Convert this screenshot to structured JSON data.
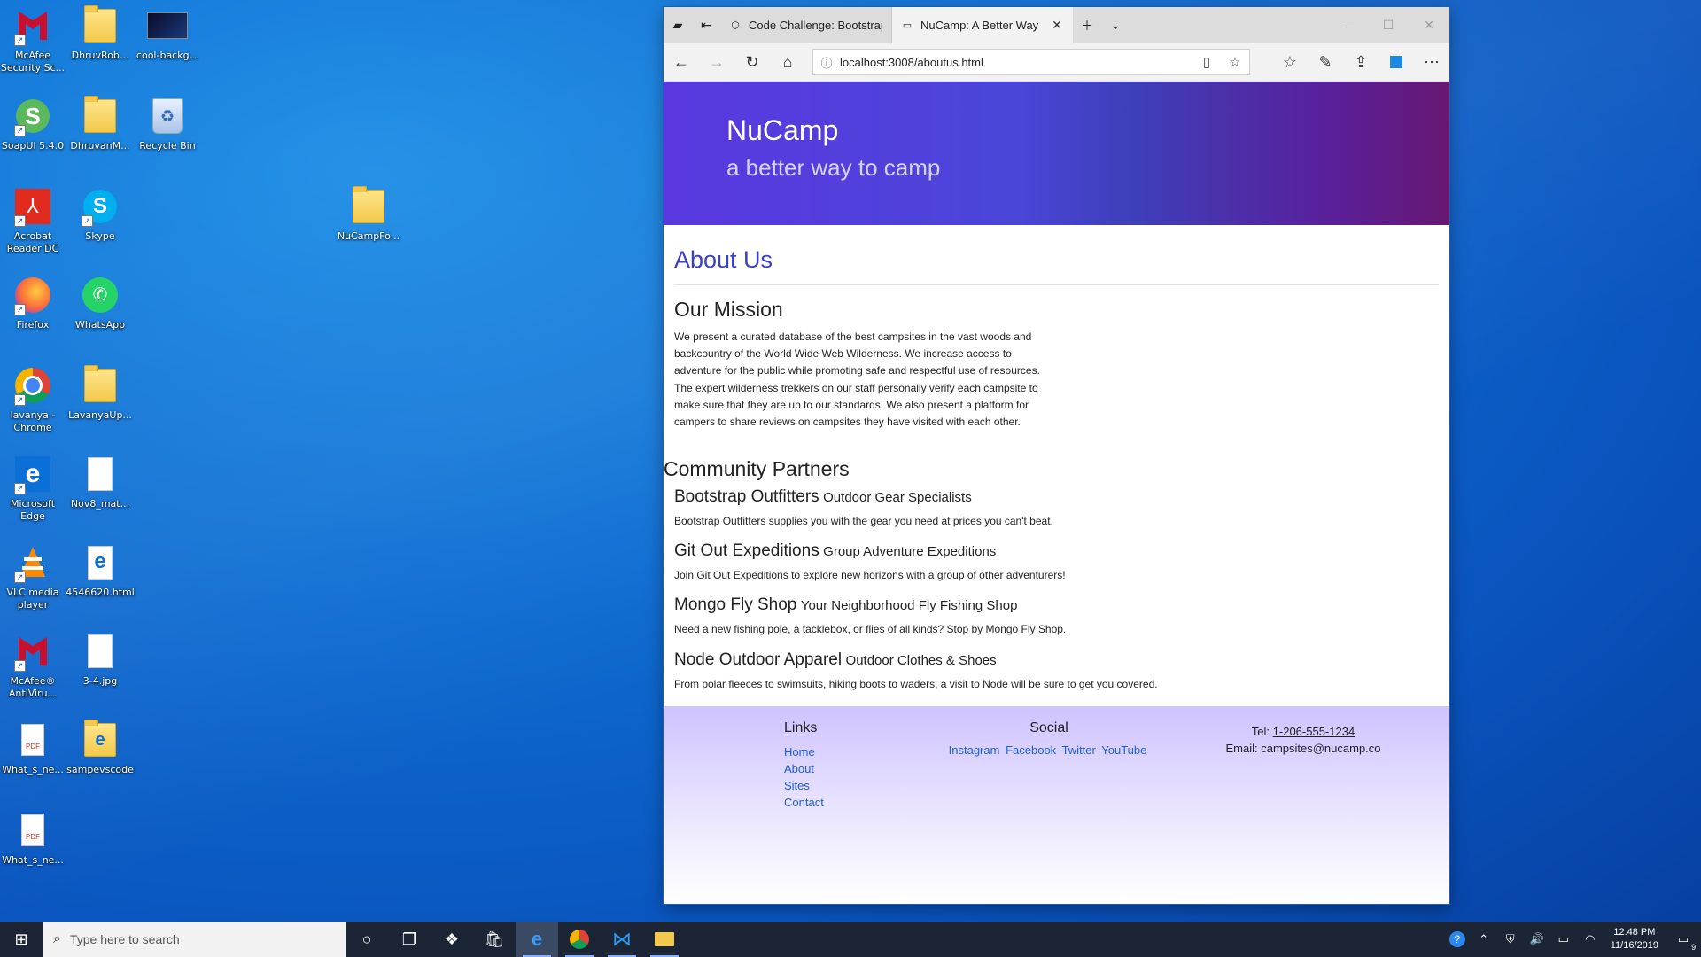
{
  "desktop": {
    "icons": [
      {
        "label": "McAfee Security Sc...",
        "icon": "mcafee-icon"
      },
      {
        "label": "DhruvRob...",
        "icon": "folder-icon"
      },
      {
        "label": "cool-backg...",
        "icon": "image-file-icon"
      },
      {
        "label": "SoapUI 5.4.0",
        "icon": "soapui-icon"
      },
      {
        "label": "DhruvanM...",
        "icon": "folder-icon"
      },
      {
        "label": "Recycle Bin",
        "icon": "recycle-bin-icon"
      },
      {
        "label": "Acrobat Reader DC",
        "icon": "acrobat-icon"
      },
      {
        "label": "Skype",
        "icon": "skype-icon"
      },
      {
        "label": "NuCampFo...",
        "icon": "folder-icon"
      },
      {
        "label": "Firefox",
        "icon": "firefox-icon"
      },
      {
        "label": "WhatsApp",
        "icon": "whatsapp-icon"
      },
      {
        "label": "lavanya - Chrome",
        "icon": "chrome-icon"
      },
      {
        "label": "LavanyaUp...",
        "icon": "folder-icon"
      },
      {
        "label": "Microsoft Edge",
        "icon": "edge-icon"
      },
      {
        "label": "Nov8_mat...",
        "icon": "text-file-icon"
      },
      {
        "label": "VLC media player",
        "icon": "vlc-icon"
      },
      {
        "label": "4546620.html",
        "icon": "edge-html-file-icon"
      },
      {
        "label": "McAfee® AntiViru...",
        "icon": "mcafee-icon"
      },
      {
        "label": "3-4.jpg",
        "icon": "image-file-icon"
      },
      {
        "label": "What_s_ne...",
        "icon": "pdf-file-icon"
      },
      {
        "label": "sampevscode",
        "icon": "folder-icon"
      },
      {
        "label": "What_s_ne...",
        "icon": "pdf-file-icon"
      }
    ]
  },
  "browser": {
    "tabs": [
      {
        "title": "Code Challenge: Bootstrap",
        "active": false
      },
      {
        "title": "NuCamp: A Better Way",
        "active": true
      }
    ],
    "address": "localhost:3008/aboutus.html"
  },
  "page": {
    "brand": "NuCamp",
    "tagline": "a better way to camp",
    "heading": "About Us",
    "mission_title": "Our Mission",
    "mission_text": "We present a curated database of the best campsites in the vast woods and backcountry of the World Wide Web Wilderness. We increase access to adventure for the public while promoting safe and respectful use of resources. The expert wilderness trekkers on our staff personally verify each campsite to make sure that they are up to our standards. We also present a platform for campers to share reviews on campsites they have visited with each other.",
    "partners_title": "Community Partners",
    "partners": [
      {
        "name": "Bootstrap Outfitters",
        "tagline": "Outdoor Gear Specialists",
        "desc": "Bootstrap Outfitters supplies you with the gear you need at prices you can't beat."
      },
      {
        "name": "Git Out Expeditions",
        "tagline": "Group Adventure Expeditions",
        "desc": "Join Git Out Expeditions to explore new horizons with a group of other adventurers!"
      },
      {
        "name": "Mongo Fly Shop",
        "tagline": "Your Neighborhood Fly Fishing Shop",
        "desc": "Need a new fishing pole, a tacklebox, or flies of all kinds? Stop by Mongo Fly Shop."
      },
      {
        "name": "Node Outdoor Apparel",
        "tagline": "Outdoor Clothes & Shoes",
        "desc": "From polar fleeces to swimsuits, hiking boots to waders, a visit to Node will be sure to get you covered."
      }
    ],
    "footer": {
      "links_title": "Links",
      "links": [
        "Home",
        "About",
        "Sites",
        "Contact"
      ],
      "social_title": "Social",
      "social": [
        "Instagram",
        "Facebook",
        "Twitter",
        "YouTube"
      ],
      "tel_label": "Tel:",
      "tel": "1-206-555-1234",
      "email_label": "Email:",
      "email": "campsites@nucamp.co"
    }
  },
  "taskbar": {
    "search_placeholder": "Type here to search",
    "time": "12:48 PM",
    "date": "11/16/2019",
    "notifications": "9"
  }
}
